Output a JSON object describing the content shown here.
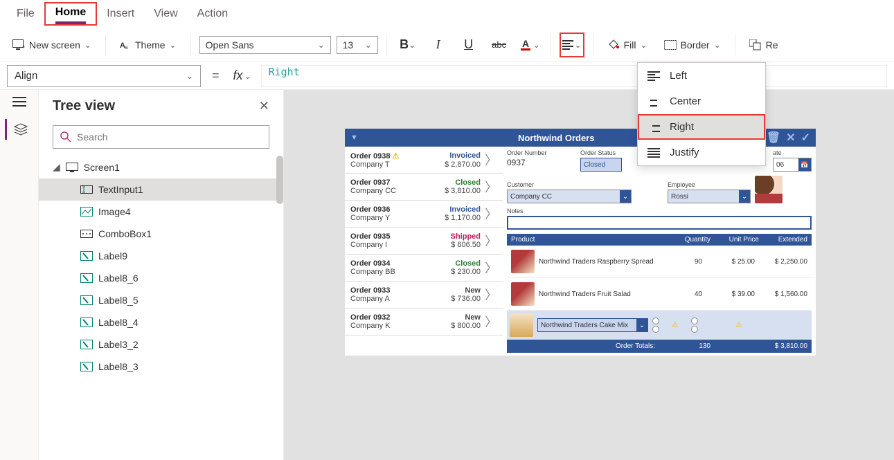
{
  "menu": {
    "file": "File",
    "home": "Home",
    "insert": "Insert",
    "view": "View",
    "action": "Action"
  },
  "ribbon": {
    "new_screen": "New screen",
    "theme": "Theme",
    "font_name": "Open Sans",
    "font_size": "13",
    "fill": "Fill",
    "border": "Border",
    "re": "Re"
  },
  "formula": {
    "property": "Align",
    "value": "Right"
  },
  "tree": {
    "title": "Tree view",
    "search_placeholder": "Search",
    "root": "Screen1",
    "items": [
      "TextInput1",
      "Image4",
      "ComboBox1",
      "Label9",
      "Label8_6",
      "Label8_5",
      "Label8_4",
      "Label3_2",
      "Label8_3"
    ],
    "selected": "TextInput1"
  },
  "align_menu": {
    "left": "Left",
    "center": "Center",
    "right": "Right",
    "justify": "Justify"
  },
  "app": {
    "title": "Northwind Orders",
    "orders": [
      {
        "id": "Order 0938",
        "company": "Company T",
        "status": "Invoiced",
        "status_cls": "invoiced",
        "amount": "$ 2,870.00",
        "warn": true
      },
      {
        "id": "Order 0937",
        "company": "Company CC",
        "status": "Closed",
        "status_cls": "closed",
        "amount": "$ 3,810.00",
        "warn": false
      },
      {
        "id": "Order 0936",
        "company": "Company Y",
        "status": "Invoiced",
        "status_cls": "invoiced",
        "amount": "$ 1,170.00",
        "warn": false
      },
      {
        "id": "Order 0935",
        "company": "Company I",
        "status": "Shipped",
        "status_cls": "shipped",
        "amount": "$ 606.50",
        "warn": false
      },
      {
        "id": "Order 0934",
        "company": "Company BB",
        "status": "Closed",
        "status_cls": "closed",
        "amount": "$ 230.00",
        "warn": false
      },
      {
        "id": "Order 0933",
        "company": "Company A",
        "status": "New",
        "status_cls": "new",
        "amount": "$ 736.00",
        "warn": false
      },
      {
        "id": "Order 0932",
        "company": "Company K",
        "status": "New",
        "status_cls": "new",
        "amount": "$ 800.00",
        "warn": false
      }
    ],
    "detail": {
      "labels": {
        "order_number": "Order Number",
        "order_status": "Order Status",
        "date": "ate",
        "customer": "Customer",
        "employee": "Employee",
        "notes": "Notes"
      },
      "order_number": "0937",
      "order_status": "Closed",
      "date": "06",
      "customer": "Company CC",
      "employee": "Rossi"
    },
    "table": {
      "headers": {
        "product": "Product",
        "quantity": "Quantity",
        "unit_price": "Unit Price",
        "extended": "Extended"
      },
      "rows": [
        {
          "name": "Northwind Traders Raspberry Spread",
          "qty": "90",
          "price": "$ 25.00",
          "ext": "$ 2,250.00"
        },
        {
          "name": "Northwind Traders Fruit Salad",
          "qty": "40",
          "price": "$ 39.00",
          "ext": "$ 1,560.00"
        }
      ],
      "selected_product": "Northwind Traders Cake Mix",
      "totals_label": "Order Totals:",
      "totals_qty": "130",
      "totals_ext": "$ 3,810.00"
    }
  }
}
